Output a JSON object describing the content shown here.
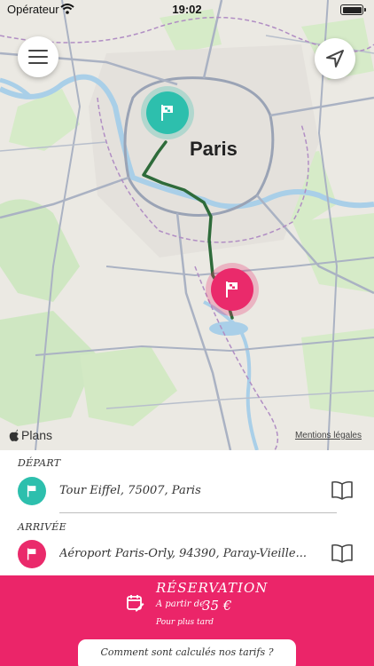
{
  "status_bar": {
    "carrier": "Opérateur",
    "time": "19:02"
  },
  "map": {
    "city_label": "Paris",
    "attribution": "Plans",
    "legal_link": "Mentions légales",
    "colors": {
      "route": "#2e6b3a",
      "start_pin": "#2dbfad",
      "end_pin": "#ea2a6b"
    }
  },
  "route": {
    "departure_label": "DÉPART",
    "departure_address": "Tour Eiffel, 75007, Paris",
    "arrival_label": "ARRIVÉE",
    "arrival_address": "Aéroport Paris-Orly, 94390, Paray-Vieille..."
  },
  "reservation": {
    "title": "RÉSERVATION",
    "price_prefix": "A partir de",
    "price": "35 €",
    "subtitle": "Pour plus tard",
    "color": "#eb2569"
  },
  "tarif_button": {
    "label": "Comment sont calculés nos tarifs ?"
  },
  "icons": {
    "menu": "hamburger-icon",
    "location": "navigation-arrow-icon",
    "flag": "flag-icon",
    "book": "book-icon",
    "calendar": "calendar-edit-icon"
  }
}
